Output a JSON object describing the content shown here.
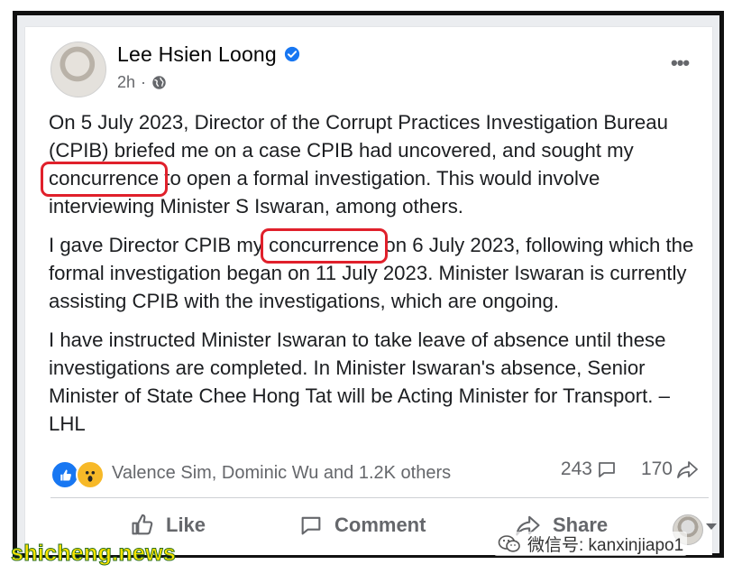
{
  "post": {
    "author": "Lee Hsien Loong",
    "time": "2h",
    "paragraphs": [
      {
        "part1": "On 5 July 2023, Director of the Corrupt Practices Investigation Bureau (CPIB) briefed me on a case CPIB had uncovered, and sought my ",
        "highlight": "concurrence",
        "part2": " to open a formal investigation. This would involve interviewing Minister S Iswaran, among others."
      },
      {
        "part1": "I gave Director CPIB my ",
        "highlight": "concurrence",
        "part2": " on 6 July 2023, following which the formal investigation began on 11 July 2023. Minister Iswaran is currently assisting CPIB with the investigations, which are ongoing."
      },
      {
        "text": "I have instructed Minister Iswaran to take leave of absence until these investigations are completed. In Minister Iswaran's absence, Senior Minister of State Chee Hong Tat will be Acting Minister for Transport. – LHL"
      }
    ]
  },
  "reactions": {
    "names": "Valence Sim, Dominic Wu and 1.2K others",
    "comments": "243",
    "shares": "170"
  },
  "actions": {
    "like": "Like",
    "comment": "Comment",
    "share": "Share"
  },
  "watermarks": {
    "left": "shicheng.news",
    "right": "微信号: kanxinjiapo1"
  },
  "colors": {
    "highlight_box": "#e0202b",
    "facebook_blue": "#1877f2",
    "secondary_text": "#65676b"
  },
  "icons": [
    "verified-badge-icon",
    "globe-icon",
    "more-options-icon",
    "like-reaction-icon",
    "wow-reaction-icon",
    "comment-icon",
    "share-icon",
    "thumbs-up-icon",
    "wechat-icon"
  ]
}
